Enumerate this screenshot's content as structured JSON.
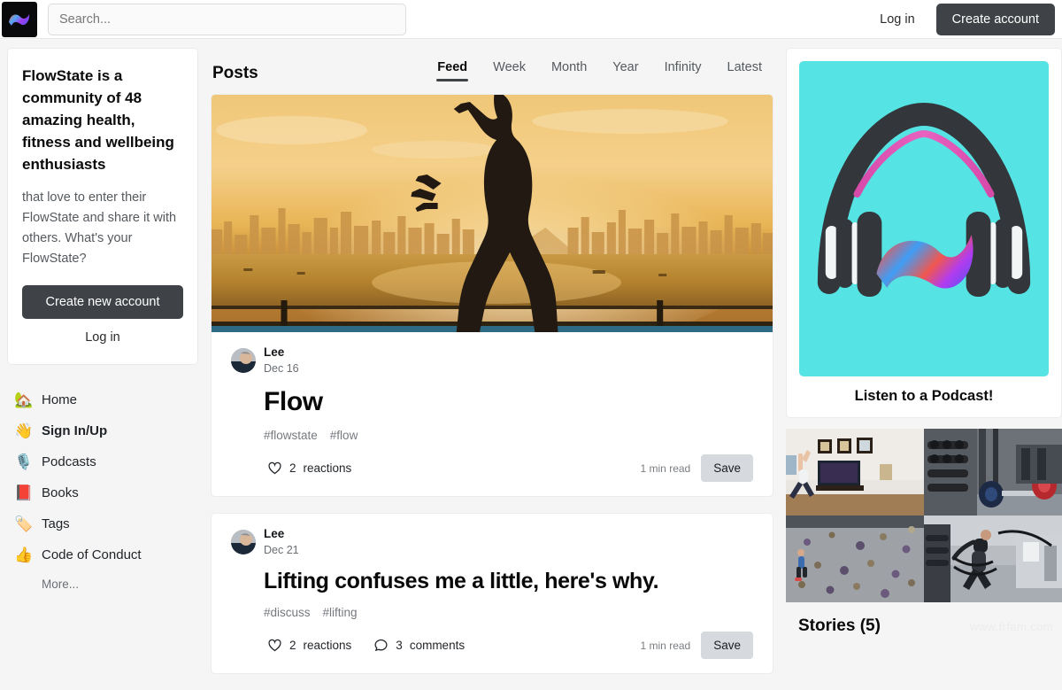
{
  "header": {
    "logo_icon": "flowstate-wave-logo",
    "search": {
      "placeholder": "Search...",
      "value": ""
    },
    "login_label": "Log in",
    "create_account_label": "Create account"
  },
  "sidebar": {
    "promo": {
      "title": "FlowState is a community of 48 amazing health, fitness and wellbeing enthusiasts",
      "body": "that love to enter their FlowState and share it with others. What's your FlowState?",
      "primary_label": "Create new account",
      "secondary_label": "Log in"
    },
    "nav": [
      {
        "label": "Home",
        "emoji": "🏡",
        "icon": "house-icon",
        "active": false
      },
      {
        "label": "Sign In/Up",
        "emoji": "👋",
        "icon": "waving-hand-icon",
        "active": true
      },
      {
        "label": "Podcasts",
        "emoji": "🎙️",
        "icon": "microphone-icon",
        "active": false
      },
      {
        "label": "Books",
        "emoji": "📕",
        "icon": "book-icon",
        "active": false
      },
      {
        "label": "Tags",
        "emoji": "🏷️",
        "icon": "tag-icon",
        "active": false
      },
      {
        "label": "Code of Conduct",
        "emoji": "👍",
        "icon": "thumbs-up-icon",
        "active": false
      }
    ],
    "more_label": "More..."
  },
  "main": {
    "title": "Posts",
    "tabs": [
      {
        "label": "Feed",
        "active": true
      },
      {
        "label": "Week",
        "active": false
      },
      {
        "label": "Month",
        "active": false
      },
      {
        "label": "Year",
        "active": false
      },
      {
        "label": "Infinity",
        "active": false
      },
      {
        "label": "Latest",
        "active": false
      }
    ],
    "posts": [
      {
        "author": "Lee",
        "date": "Dec 16",
        "title": "Flow",
        "tags": [
          "#flowstate",
          "#flow"
        ],
        "reactions_count": "2",
        "reactions_label": "reactions",
        "comments_count": "",
        "comments_label": "",
        "read_time": "1 min read",
        "save_label": "Save",
        "cover_alt": "martial-artist-statue-silhouette-at-sunset"
      },
      {
        "author": "Lee",
        "date": "Dec 21",
        "title": "Lifting confuses me a little, here's why.",
        "tags": [
          "#discuss",
          "#lifting"
        ],
        "reactions_count": "2",
        "reactions_label": "reactions",
        "comments_count": "3",
        "comments_label": "comments",
        "read_time": "1 min read",
        "save_label": "Save",
        "cover_alt": ""
      }
    ]
  },
  "rightbar": {
    "podcast": {
      "caption": "Listen to a Podcast!",
      "art_alt": "headphones-with-flowstate-wave",
      "art_bg": "#55e3e3"
    },
    "stories": {
      "title": "Stories (5)",
      "cells": [
        {
          "alt": "woman-stretching-in-living-room"
        },
        {
          "alt": "home-gym-with-barbell-and-weights"
        },
        {
          "alt": "indoor-bouldering-climbing-wall"
        },
        {
          "alt": "woman-training-with-battle-ropes"
        }
      ]
    }
  },
  "watermark": "www.frfam.com",
  "colors": {
    "accent_dark": "#3f4246",
    "page_bg": "#f5f5f5",
    "card_bg": "#ffffff",
    "save_btn_bg": "#d6d9dd",
    "podcast_bg": "#55e3e3"
  }
}
